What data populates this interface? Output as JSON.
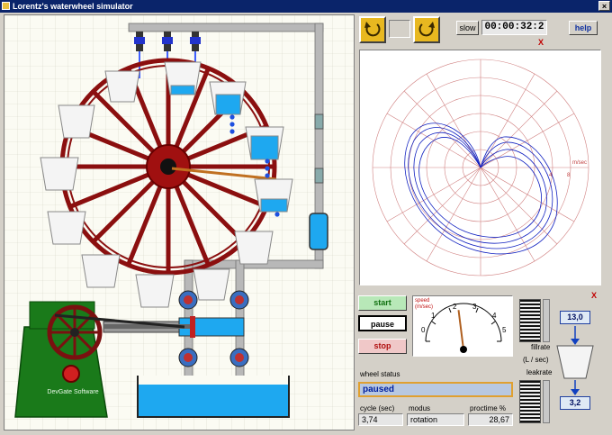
{
  "window": {
    "title": "Lorentz's waterwheel simulator",
    "close_glyph": "×"
  },
  "toolbar": {
    "speed_label": "slow",
    "timer": "00:00:32:2",
    "help_label": "help",
    "reset_icon": "rotate-back-icon",
    "replay_icon": "rotate-forward-icon"
  },
  "plot_panel": {
    "axis_unit": "m/sec",
    "tick_labels": [
      "4",
      "8"
    ],
    "close_glyph": "X"
  },
  "controls": {
    "start_label": "start",
    "pause_label": "pause",
    "stop_label": "stop",
    "close_glyph": "X"
  },
  "gauge": {
    "title": "speed\n(m/sec)",
    "ticks": [
      "0",
      "1",
      "2",
      "3",
      "4",
      "5"
    ],
    "value": 2.3
  },
  "flow": {
    "fillrate_label": "fillrate",
    "unit_label": "(L / sec)",
    "leakrate_label": "leakrate",
    "fillrate_value": "13,0",
    "leakrate_value": "3,2"
  },
  "status": {
    "label": "wheel status",
    "value": "paused"
  },
  "readouts": {
    "cycle_label": "cycle (sec)",
    "cycle_value": "3,74",
    "modus_label": "modus",
    "modus_value": "rotation",
    "proctime_label": "proctime %",
    "proctime_value": "28,67"
  },
  "machine": {
    "brand": "DevGate Software"
  },
  "colors": {
    "wheel": "#8b0f0f",
    "water": "#1ea8f0",
    "frame": "#1a7a1a",
    "accent": "#d02020"
  }
}
